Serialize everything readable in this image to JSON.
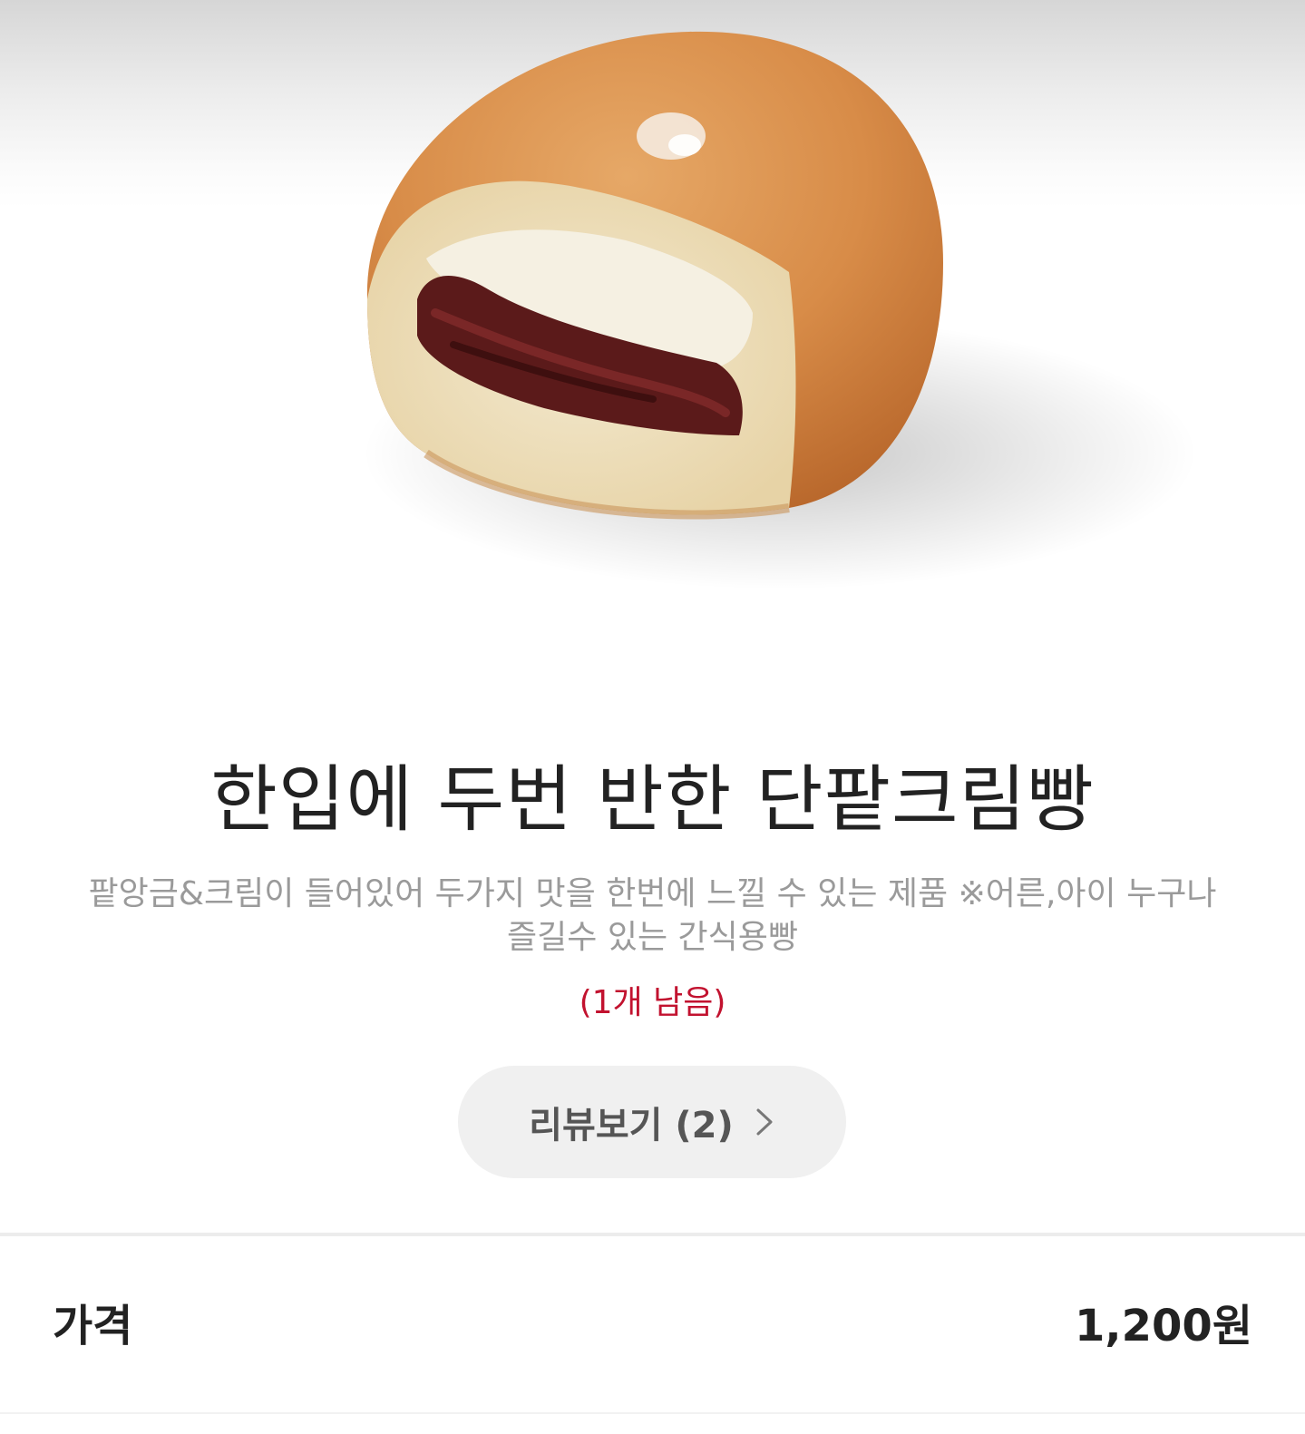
{
  "product": {
    "image_alt": "단팥크림빵",
    "title": "한입에 두번 반한 단팥크림빵",
    "description": "팥앙금&크림이 들어있어 두가지 맛을 한번에 느낄 수 있는 제품 ※어른,아이 누구나 즐길수 있는 간식용빵",
    "stock_status": "(1개 남음)"
  },
  "review_button": {
    "label": "리뷰보기 (2)",
    "icon": "chevron-right-icon"
  },
  "price": {
    "label": "가격",
    "value": "1,200원"
  },
  "colors": {
    "stock_red": "#c2122f",
    "button_bg": "#f0f0f0",
    "text_dark": "#222222",
    "text_muted": "#9a9a9a"
  }
}
